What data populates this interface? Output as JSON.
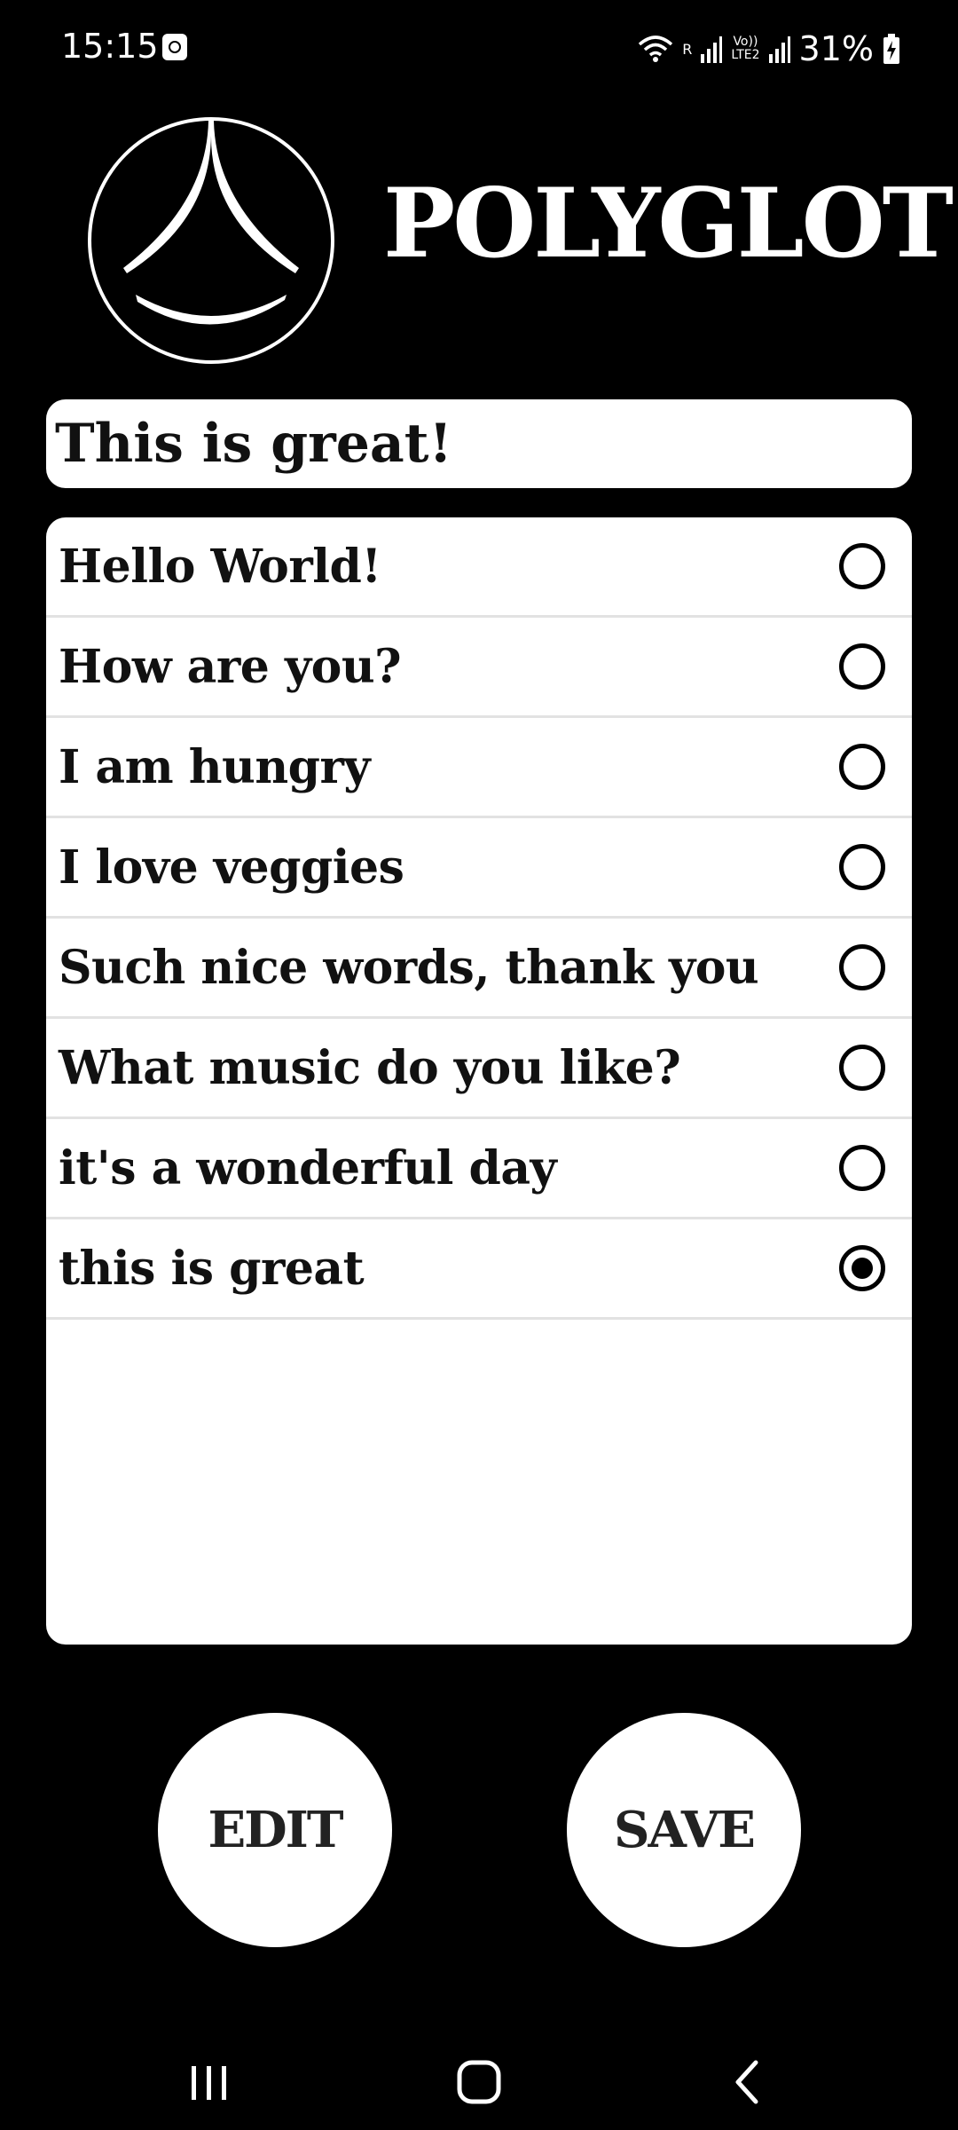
{
  "status_bar": {
    "time": "15:15",
    "network_r": "R",
    "network_lte_top": "Vo))",
    "network_lte_bottom": "LTE2",
    "battery_percent": "31%",
    "icons": [
      "clock-app-icon",
      "wifi-icon",
      "signal-icon",
      "signal-icon",
      "battery-charging-icon"
    ]
  },
  "header": {
    "title": "POLYGLOT",
    "logo_icon": "polyglot-logo-icon"
  },
  "phrase_input": {
    "value": "This is great!"
  },
  "phrase_list": {
    "items": [
      {
        "label": "Hello World!",
        "selected": false
      },
      {
        "label": "How are you?",
        "selected": false
      },
      {
        "label": "I am hungry",
        "selected": false
      },
      {
        "label": "I love veggies",
        "selected": false
      },
      {
        "label": "Such nice words, thank you",
        "selected": false
      },
      {
        "label": "What music do you like?",
        "selected": false
      },
      {
        "label": "it's a wonderful day",
        "selected": false
      },
      {
        "label": "this is great",
        "selected": true
      }
    ]
  },
  "actions": {
    "edit_label": "EDIT",
    "save_label": "SAVE"
  },
  "nav_bar": {
    "icons": [
      "recents-icon",
      "home-icon",
      "back-icon"
    ]
  },
  "colors": {
    "background": "#000000",
    "surface": "#ffffff",
    "text_dark": "#111111",
    "divider": "#e2e2e2"
  }
}
